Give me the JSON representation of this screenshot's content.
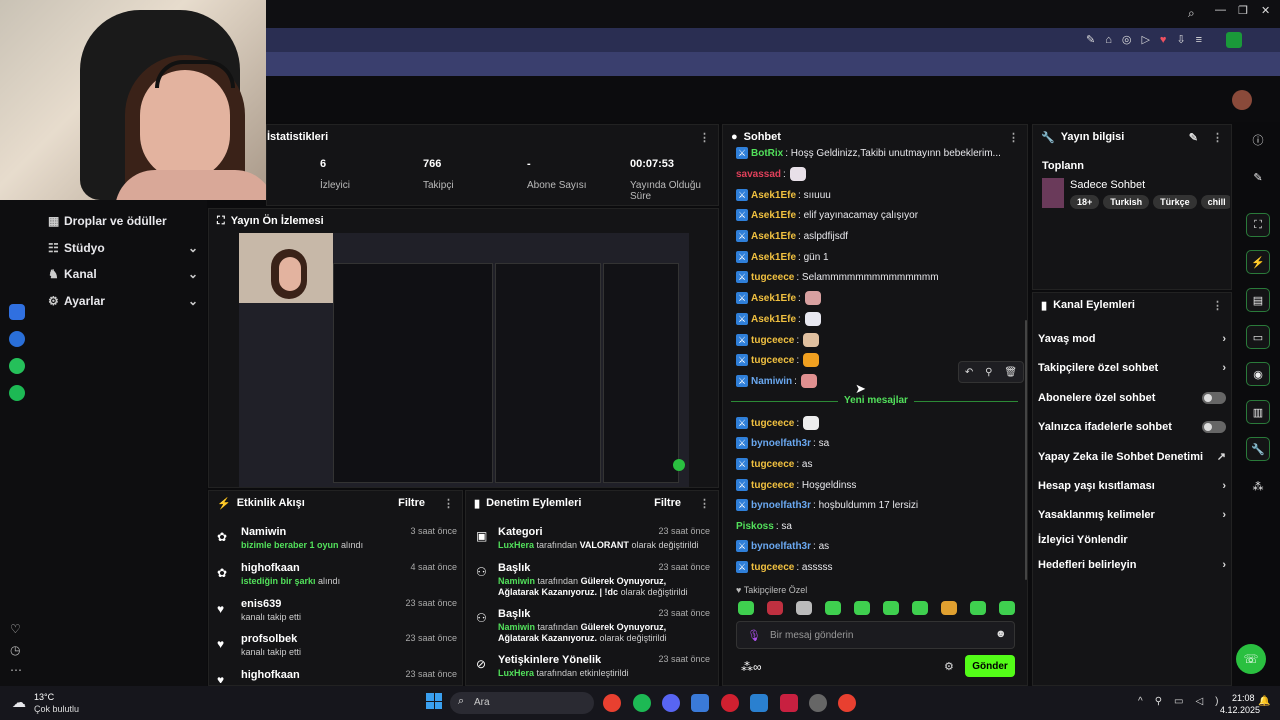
{
  "stats": {
    "title": "İstatistikleri",
    "items": [
      {
        "value": "6",
        "label": "İzleyici"
      },
      {
        "value": "766",
        "label": "Takipçi"
      },
      {
        "value": "-",
        "label": "Abone Sayısı"
      },
      {
        "value": "00:07:53",
        "label": "Yayında Olduğu Süre"
      }
    ]
  },
  "nav": {
    "items": [
      {
        "label": "Droplar ve ödüller",
        "icon": "gift-icon"
      },
      {
        "label": "Stüdyo",
        "icon": "studio-icon"
      },
      {
        "label": "Kanal",
        "icon": "channel-icon"
      },
      {
        "label": "Ayarlar",
        "icon": "gear-icon"
      }
    ]
  },
  "preview": {
    "title": "Yayın Ön İzlemesi"
  },
  "activity": {
    "title": "Etkinlik Akışı",
    "filter": "Filtre",
    "rows": [
      {
        "name": "Namiwin",
        "text": "bizimle beraber 1 oyun",
        "suffix": "alındı",
        "time": "3 saat önce"
      },
      {
        "name": "highofkaan",
        "text": "istediğin bir şarkı",
        "suffix": "alındı",
        "time": "4 saat önce"
      },
      {
        "name": "enis639",
        "text": "",
        "suffix": "kanalı takip etti",
        "time": "23 saat önce"
      },
      {
        "name": "profsolbek",
        "text": "",
        "suffix": "kanalı takip etti",
        "time": "23 saat önce"
      },
      {
        "name": "highofkaan",
        "text": "",
        "suffix": "",
        "time": "23 saat önce"
      }
    ]
  },
  "moderation": {
    "title": "Denetim Eylemleri",
    "filter": "Filtre",
    "rows": [
      {
        "name": "Kategori",
        "actor": "LuxHera",
        "mid": "tarafından",
        "value": "VALORANT",
        "end": "olarak değiştirildi",
        "time": "23 saat önce"
      },
      {
        "name": "Başlık",
        "actor": "Namiwin",
        "mid": "tarafından",
        "value": "Gülerek Oynuyoruz, Ağlatarak Kazanıyoruz. | !dc",
        "end": "olarak değiştirildi",
        "time": "23 saat önce"
      },
      {
        "name": "Başlık",
        "actor": "Namiwin",
        "mid": "tarafından",
        "value": "Gülerek Oynuyoruz, Ağlatarak Kazanıyoruz.",
        "end": "olarak değiştirildi",
        "time": "23 saat önce"
      },
      {
        "name": "Yetişkinlere Yönelik",
        "actor": "LuxHera",
        "mid": "tarafından etkinleştirildi",
        "value": "",
        "end": "",
        "time": "23 saat önce"
      }
    ]
  },
  "chat": {
    "title": "Sohbet",
    "messages": [
      {
        "user": "BotRix",
        "color": "#52e05b",
        "text": ": Hoşş Geldinizz,Takibi unutmayınn bebeklerim...",
        "badge": true
      },
      {
        "user": "savassad",
        "color": "#e0405a",
        "text": ":",
        "badge": false,
        "emote": "#e8e0e8"
      },
      {
        "user": "Asek1Efe",
        "color": "#f0c040",
        "text": ": sııuuu",
        "badge": true
      },
      {
        "user": "Asek1Efe",
        "color": "#f0c040",
        "text": ": elif yayınacamay çalışıyor",
        "badge": true
      },
      {
        "user": "Asek1Efe",
        "color": "#f0c040",
        "text": ": aslpdfijsdf",
        "badge": true
      },
      {
        "user": "Asek1Efe",
        "color": "#f0c040",
        "text": ": gün 1",
        "badge": true
      },
      {
        "user": "tugceece",
        "color": "#f0c040",
        "text": ": Selammmmmmmmmmmmmm",
        "badge": true
      },
      {
        "user": "Asek1Efe",
        "color": "#f0c040",
        "text": ":",
        "badge": true,
        "emote": "#d8a0a0"
      },
      {
        "user": "Asek1Efe",
        "color": "#f0c040",
        "text": ":",
        "badge": true,
        "emote": "#e8e8f0"
      },
      {
        "user": "tugceece",
        "color": "#f0c040",
        "text": ":",
        "badge": true,
        "emote": "#e0c0a0"
      },
      {
        "user": "tugceece",
        "color": "#f0c040",
        "text": ":",
        "badge": true,
        "emote": "#f0a020"
      },
      {
        "user": "Namiwin",
        "color": "#6aa8f0",
        "text": ":",
        "badge": true,
        "emote": "#e09090"
      },
      {
        "user": "tugceece",
        "color": "#f0c040",
        "text": ":",
        "badge": true,
        "emote": "#eeeeee"
      },
      {
        "user": "bynoelfath3r",
        "color": "#6aa8f0",
        "text": ": sa",
        "badge": true
      },
      {
        "user": "tugceece",
        "color": "#f0c040",
        "text": ": as",
        "badge": true
      },
      {
        "user": "tugceece",
        "color": "#f0c040",
        "text": ": Hoşgeldinss",
        "badge": true
      },
      {
        "user": "bynoelfath3r",
        "color": "#6aa8f0",
        "text": ": hoşbuldumm 17 lersizi",
        "badge": true
      },
      {
        "user": "Piskoss",
        "color": "#52e05b",
        "text": ": sa",
        "badge": false
      },
      {
        "user": "bynoelfath3r",
        "color": "#6aa8f0",
        "text": ": as",
        "badge": true
      },
      {
        "user": "tugceece",
        "color": "#f0c040",
        "text": ": asssss",
        "badge": true
      }
    ],
    "new_messages": "Yeni mesajlar",
    "followers_only": "Takipçilere Özel",
    "input_placeholder": "Bir mesaj gönderin",
    "send": "Gönder"
  },
  "stream_info": {
    "title": "Yayın bilgisi",
    "stream_title": "Toplann",
    "category": "Sadece Sohbet",
    "tags": [
      "18+",
      "Turkish",
      "Türkçe",
      "chill"
    ]
  },
  "channel_actions": {
    "title": "Kanal Eylemleri",
    "items": [
      {
        "label": "Yavaş mod",
        "ctrl": "chevron"
      },
      {
        "label": "Takipçilere özel sohbet",
        "ctrl": "chevron"
      },
      {
        "label": "Abonelere özel sohbet",
        "ctrl": "toggle"
      },
      {
        "label": "Yalnızca ifadelerle sohbet",
        "ctrl": "toggle"
      },
      {
        "label": "Yapay Zeka ile Sohbet Denetimi",
        "ctrl": "external"
      },
      {
        "label": "Hesap yaşı kısıtlaması",
        "ctrl": "chevron"
      },
      {
        "label": "Yasaklanmış kelimeler",
        "ctrl": "chevron"
      },
      {
        "label": "İzleyici Yönlendir",
        "ctrl": "none"
      },
      {
        "label": "Hedefleri belirleyin",
        "ctrl": "chevron"
      }
    ]
  },
  "taskbar": {
    "weather_temp": "13°C",
    "weather_desc": "Çok bulutlu",
    "search": "Ara",
    "time": "21:08",
    "date": "4.12.2025"
  },
  "colors": {
    "accent": "#52e05b",
    "badge": "#2f7fd9"
  }
}
